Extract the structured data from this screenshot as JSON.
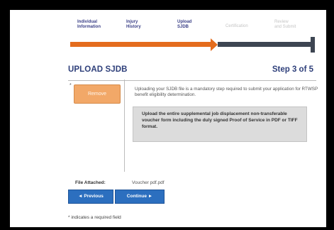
{
  "steps": [
    {
      "label": "Individual\nInformation",
      "state": "complete"
    },
    {
      "label": "Injury\nHistory",
      "state": "complete"
    },
    {
      "label": "Upload\nSJDB",
      "state": "current"
    },
    {
      "label": "Certification",
      "state": "upcoming"
    },
    {
      "label": "Review\nand Submit",
      "state": "upcoming"
    }
  ],
  "progress": {
    "completed_steps": 3,
    "total_steps": 5
  },
  "header": {
    "title": "UPLOAD SJDB",
    "step_indicator": "Step 3 of 5"
  },
  "upload": {
    "required_marker": "*",
    "remove_label": "Remove",
    "description": "Uploading your SJDB file is a mandatory step required to submit your application for RTWSP benefit eligibility determination.",
    "instructions": "Upload the entire supplemental job displacement non-transferable voucher form including the duly signed Proof of Service in PDF or TIFF format."
  },
  "file": {
    "label": "File Attached:",
    "value": "Voucher pdf.pdf"
  },
  "nav": {
    "previous_label": "◄ Previous",
    "continue_label": "Continue ►"
  },
  "footer": {
    "required_note": "* indicates a required field"
  },
  "colors": {
    "accent": "#e46c1d",
    "primary": "#2c6fbf",
    "heading": "#2e3f7a",
    "track_inactive": "#3d4552"
  }
}
